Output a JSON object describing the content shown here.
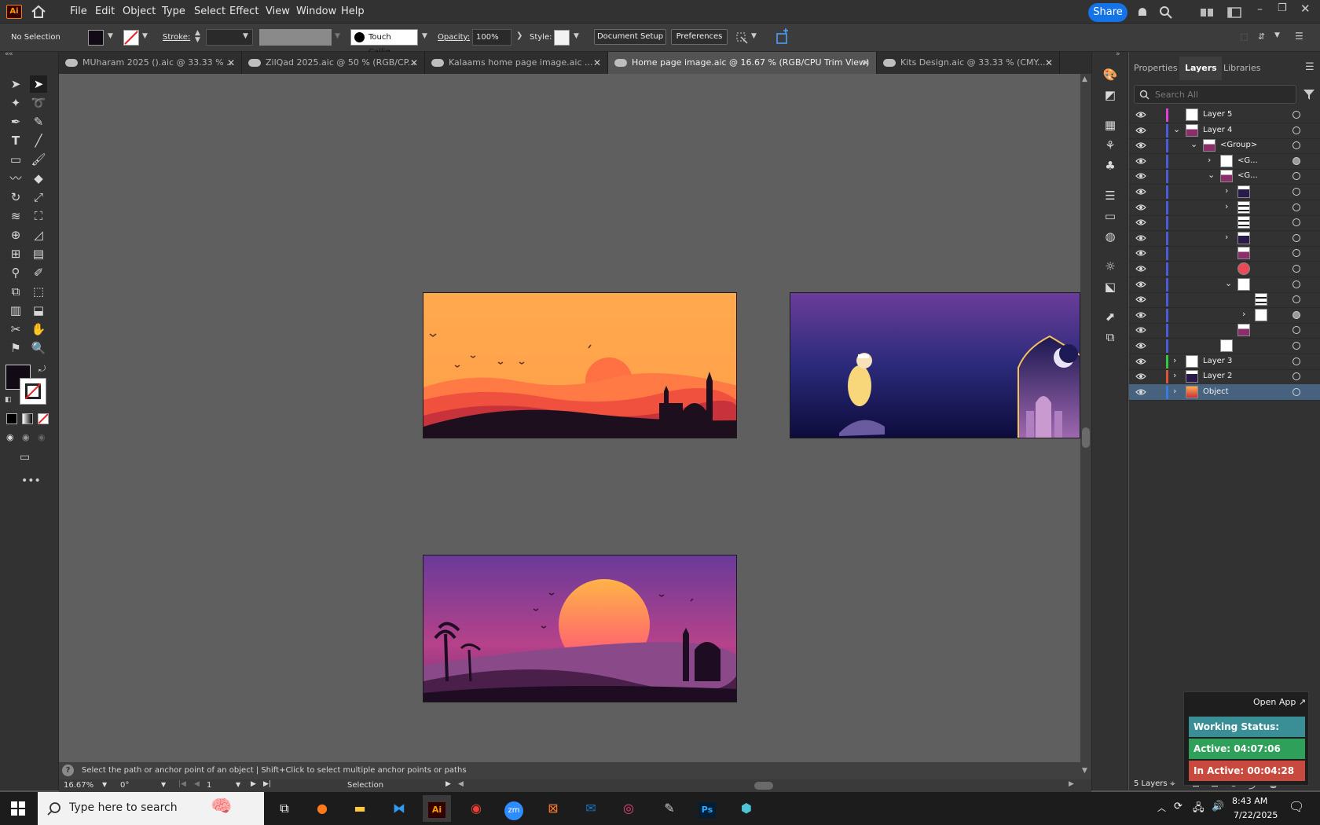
{
  "menubar": {
    "app_logo": "Ai",
    "items": [
      "File",
      "Edit",
      "Object",
      "Type",
      "Select",
      "Effect",
      "View",
      "Window",
      "Help"
    ],
    "share_label": "Share"
  },
  "controlbar": {
    "selection_label": "No Selection",
    "stroke_label": "Stroke:",
    "brush_name": "Touch Callig...",
    "opacity_label": "Opacity:",
    "opacity_value": "100%",
    "style_label": "Style:",
    "document_setup": "Document Setup",
    "preferences": "Preferences"
  },
  "tabs": [
    {
      "label": "MUharam 2025 ().aic @ 33.33 % ...",
      "active": false
    },
    {
      "label": "ZilQad 2025.aic @ 50 % (RGB/CP...",
      "active": false
    },
    {
      "label": "Kalaams home page image.aic ...",
      "active": false
    },
    {
      "label": "Home page image.aic @ 16.67 % (RGB/CPU Trim View)",
      "active": true
    },
    {
      "label": "Kits Design.aic @ 33.33 % (CMY...",
      "active": false
    }
  ],
  "panel": {
    "tabs": [
      "Properties",
      "Layers",
      "Libraries"
    ],
    "active_tab": "Layers",
    "search_placeholder": "Search All",
    "layers_count": "5 Layers",
    "rows": [
      {
        "name": "Layer 5",
        "indent": 0,
        "chevron": "",
        "color": "#e23fe0",
        "thumb": "white"
      },
      {
        "name": "Layer 4",
        "indent": 0,
        "chevron": "v",
        "color": "#4a5bdc",
        "thumb": "sunset"
      },
      {
        "name": "<Group>",
        "indent": 1,
        "chevron": "v",
        "color": "#4a5bdc",
        "thumb": "sunset"
      },
      {
        "name": "<G...",
        "indent": 2,
        "chevron": ">",
        "color": "#4a5bdc",
        "thumb": "white"
      },
      {
        "name": "<G...",
        "indent": 2,
        "chevron": "v",
        "color": "#4a5bdc",
        "thumb": "sunset"
      },
      {
        "name": "",
        "indent": 3,
        "chevron": ">",
        "color": "#4a5bdc",
        "thumb": "dark"
      },
      {
        "name": "",
        "indent": 3,
        "chevron": ">",
        "color": "#4a5bdc",
        "thumb": "bars"
      },
      {
        "name": "",
        "indent": 3,
        "chevron": "",
        "color": "#4a5bdc",
        "thumb": "bars"
      },
      {
        "name": "",
        "indent": 3,
        "chevron": ">",
        "color": "#4a5bdc",
        "thumb": "dark"
      },
      {
        "name": "",
        "indent": 3,
        "chevron": "",
        "color": "#4a5bdc",
        "thumb": "sunset"
      },
      {
        "name": "",
        "indent": 3,
        "chevron": "",
        "color": "#4a5bdc",
        "thumb": "red"
      },
      {
        "name": "",
        "indent": 3,
        "chevron": "v",
        "color": "#4a5bdc",
        "thumb": "white"
      },
      {
        "name": "",
        "indent": 4,
        "chevron": "",
        "color": "#4a5bdc",
        "thumb": "bars"
      },
      {
        "name": "",
        "indent": 4,
        "chevron": ">",
        "color": "#4a5bdc",
        "thumb": "white"
      },
      {
        "name": "",
        "indent": 3,
        "chevron": "",
        "color": "#4a5bdc",
        "thumb": "sunset"
      },
      {
        "name": "",
        "indent": 2,
        "chevron": "",
        "color": "#4a5bdc",
        "thumb": "white"
      },
      {
        "name": "Layer 3",
        "indent": 0,
        "chevron": ">",
        "color": "#35c940",
        "thumb": "white"
      },
      {
        "name": "Layer 2",
        "indent": 0,
        "chevron": ">",
        "color": "#e0533b",
        "thumb": "dark"
      },
      {
        "name": "Object",
        "indent": 0,
        "chevron": ">",
        "color": "#3a7be0",
        "thumb": "orange",
        "selected": true
      }
    ]
  },
  "status": {
    "hint": "Select the path or anchor point of an object  |  Shift+Click to select multiple anchor points or paths",
    "zoom": "16.67%",
    "rotation": "0°",
    "artboard_num": "1",
    "tool_name": "Selection"
  },
  "widget": {
    "open_app": "Open App ↗",
    "working": "Working Status: Active",
    "active": "Active: 04:07:06",
    "inactive": "In Active: 00:04:28"
  },
  "taskbar": {
    "search_placeholder": "Type here to search",
    "time": "8:43 AM",
    "date": "7/22/2025"
  }
}
